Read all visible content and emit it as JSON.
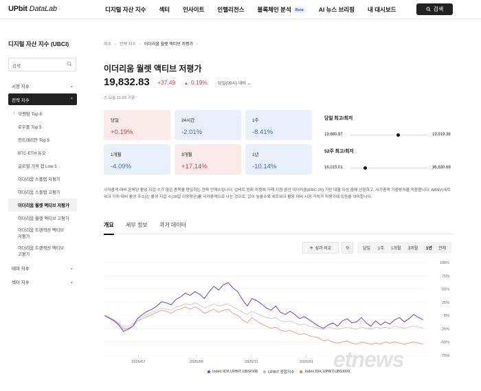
{
  "header": {
    "logo_main": "UPbit",
    "logo_sub": " DataLab",
    "nav": [
      "디지털 자산 지수",
      "섹터",
      "인사이트",
      "인텔리전스",
      "블록체인 분석",
      "AI 뉴스 브리핑",
      "내 대시보드"
    ],
    "beta_label": "Beta",
    "search_label": "검색"
  },
  "sidebar": {
    "title": "디지털 자산 지수 (UBCI)",
    "search_placeholder": "검색",
    "market_index": "시장 지수",
    "strategy_index": "전략 지수",
    "strategy_items": [
      "모멘텀 Top 5",
      "로우볼 Top 5",
      "컨트래리안 Top 5",
      "BTC-ETH 듀오",
      "글로벌 가격 갭 Low 5",
      "이더리움 스플렙 저평가",
      "이더리움 스플렙 고평가",
      "이더리움 월렛 액티브 저평가",
      "이더리움 월렛 액티브 고평가",
      "이더리움 트랜잭션 액티브\n저평가",
      "이더리움 트랜잭션 액티브\n고평가"
    ],
    "theme_index": "테마 지수",
    "sector_index": "섹터 지수"
  },
  "breadcrumb": [
    "지수",
    "전략 지수",
    "이더리움 월렛 액티브 저평가"
  ],
  "index": {
    "title": "이더리움 월렛 액티브 저평가",
    "price": "19,832.83",
    "change": "+37.49",
    "change_pct": "0.19%",
    "basis": "당일(09시) 대비",
    "time_note": "오늘 11:03 기준"
  },
  "cards": [
    {
      "label": "당일",
      "value": "+0.19%",
      "dir": "up"
    },
    {
      "label": "24시간",
      "value": "-2.01%",
      "dir": "down"
    },
    {
      "label": "1주",
      "value": "-8.41%",
      "dir": "down"
    },
    {
      "label": "1개월",
      "value": "-4.09%",
      "dir": "down"
    },
    {
      "label": "3개월",
      "value": "+17.14%",
      "dir": "up"
    },
    {
      "label": "1년",
      "value": "-10.14%",
      "dir": "down"
    }
  ],
  "ranges": [
    {
      "title": "당일 최고/최저",
      "low": "19,680.97",
      "high": "19,919.36",
      "position": 0.6
    },
    {
      "title": "52주 최고/최저",
      "low": "16,015.01",
      "high": "36,630.68",
      "position": 0.17
    }
  ],
  "description": "시가총액 대비 온체인 활성 지갑 수가 많은 종목을 편입하는 전략 인덱스입니다. 업비트 원화 마켓에 거래 지원 중인 이더리움(ERC-20) 기반 대형 자산 중에 선정하고, 시가총액 가중방식을 적용합니다. AANV(네트워크 가치 대비 활성 주소)는 활성 지갑 수(30일 이동평균)를 시가총액으로 나눈 것으로, 값이 높을수록 네트워크 활동 대비 시장 가치가 저평가돼 있음을 의미합니다.",
  "tabs": [
    "개요",
    "세부 정보",
    "과거 데이터"
  ],
  "toolbar": {
    "compare_label": "성과 비교",
    "periods": [
      "당일",
      "1주",
      "1개월",
      "3개월",
      "1년",
      "전체"
    ],
    "active_period": "1년"
  },
  "watermark": "etnews",
  "chart_data": {
    "type": "line",
    "x_ticks": [
      "2025/07",
      "2025/09",
      "2025/11",
      "2026/01"
    ],
    "y_ticks": [
      "100%",
      "75%",
      "50%",
      "25%",
      "0%",
      "-25%",
      "-50%",
      "-75%"
    ],
    "ylim": [
      -75,
      100
    ],
    "series": [
      {
        "name": "Index IDX.UPBIT.UBSI008",
        "color": "#6a3fd8",
        "values": [
          0,
          -5,
          -10,
          -18,
          -30,
          -26,
          -20,
          -5,
          2,
          8,
          12,
          18,
          26,
          24,
          20,
          30,
          35,
          42,
          38,
          45,
          40,
          32,
          45,
          55,
          48,
          58,
          62,
          52,
          45,
          30,
          18,
          32,
          28,
          22,
          14,
          10,
          18,
          6,
          2,
          8,
          2,
          -6,
          -2,
          -8,
          -14,
          -20,
          -24,
          -18,
          -14,
          -20,
          -10,
          -6,
          -14,
          -12,
          -4,
          -14,
          -20,
          -10,
          -18,
          -12,
          -16,
          -8,
          -4,
          -12,
          -6,
          2,
          -4,
          -8
        ]
      },
      {
        "name": "UPBIT 종합지수",
        "color": "#b8b8b8",
        "values": [
          0,
          -3,
          -8,
          -14,
          -22,
          -20,
          -16,
          -6,
          -2,
          2,
          6,
          10,
          14,
          12,
          10,
          16,
          18,
          22,
          20,
          24,
          20,
          14,
          18,
          22,
          18,
          20,
          22,
          16,
          12,
          6,
          2,
          8,
          4,
          0,
          -4,
          -6,
          -4,
          -10,
          -12,
          -10,
          -14,
          -18,
          -16,
          -20,
          -22,
          -24,
          -26,
          -22,
          -24,
          -26,
          -24,
          -22,
          -24,
          -26,
          -22,
          -24,
          -26,
          -22,
          -24,
          -22,
          -24,
          -20,
          -22,
          -24,
          -22,
          -20,
          -22,
          -24
        ]
      },
      {
        "name": "Index IDX.UPBIT.UBSI009",
        "color": "#e07a5f",
        "values": [
          0,
          -4,
          -9,
          -16,
          -26,
          -24,
          -20,
          -10,
          -6,
          -2,
          2,
          6,
          10,
          8,
          4,
          10,
          12,
          16,
          12,
          16,
          12,
          4,
          8,
          12,
          6,
          10,
          12,
          4,
          0,
          -8,
          -14,
          -4,
          -10,
          -16,
          -20,
          -24,
          -22,
          -28,
          -30,
          -28,
          -32,
          -36,
          -34,
          -38,
          -40,
          -42,
          -48,
          -46,
          -50,
          -52,
          -50,
          -48,
          -52,
          -54,
          -50,
          -52,
          -54,
          -52,
          -54,
          -50,
          -52,
          -50,
          -52,
          -54,
          -52,
          -50,
          -52,
          -54
        ]
      }
    ]
  }
}
